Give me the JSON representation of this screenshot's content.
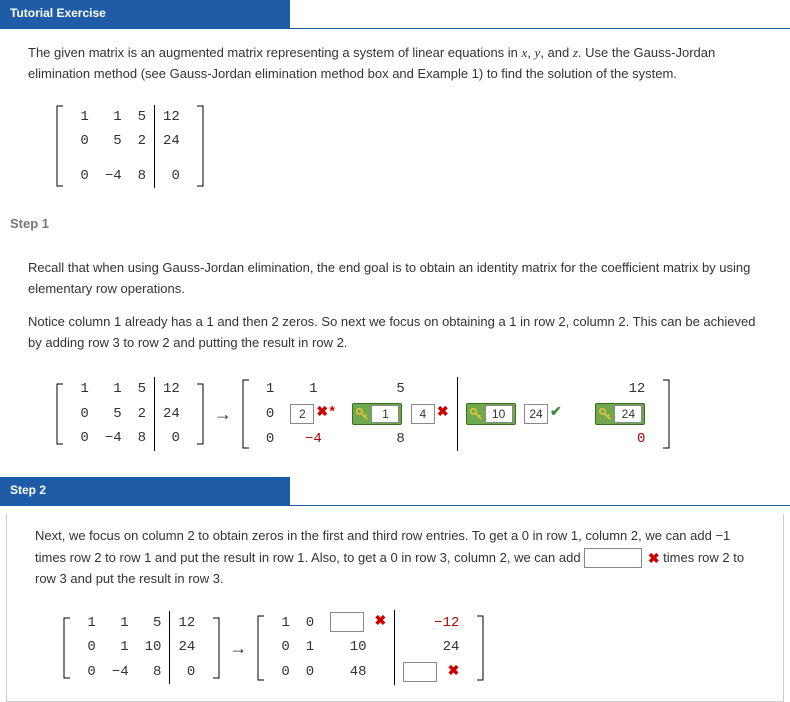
{
  "tutorial_header": "Tutorial Exercise",
  "intro": {
    "text1": "The given matrix is an augmented matrix representing a system of linear equations in ",
    "vars": "x, y, and z",
    "text2": ". Use the Gauss-Jordan elimination method (see Gauss-Jordan elimination method box and Example 1) to find the solution of the system.",
    "matrix": {
      "r1": [
        "1",
        "1",
        "5",
        "12"
      ],
      "r2": [
        "0",
        "5",
        "2",
        "24"
      ],
      "r3": [
        "0",
        "−4",
        "8",
        "0"
      ]
    }
  },
  "step1": {
    "label": "Step 1",
    "p1": "Recall that when using Gauss-Jordan elimination, the end goal is to obtain an identity matrix for the coefficient matrix by using elementary row operations.",
    "p2": "Notice column 1 already has a 1 and then 2 zeros. So next we focus on obtaining a 1 in row 2, column 2. This can be achieved by adding row 3 to row 2 and putting the result in row 2.",
    "leftMatrix": {
      "r1": [
        "1",
        "1",
        "5",
        "12"
      ],
      "r2": [
        "0",
        "5",
        "2",
        "24"
      ],
      "r3": [
        "0",
        "−4",
        "8",
        "0"
      ]
    },
    "rightMatrix": {
      "r1c1": "1",
      "r1c2": "1",
      "r1c3": "5",
      "r1c4": "12",
      "r2c1": "0",
      "r2c2_input": "2",
      "r2c2_mark": "✖*",
      "r2c3_key": "1",
      "r2c3_after": "4",
      "r2c3_mark": "✖",
      "r2c4_key": "10",
      "r2c4_after": "24",
      "r2c4_mark": "✔",
      "r2c5_key": "24",
      "r3c1": "0",
      "r3c2": "−4",
      "r3c3": "8",
      "r3c4": "0"
    }
  },
  "step2": {
    "label": "Step 2",
    "p1a": "Next, we focus on column 2 to obtain zeros in the first and third row entries. To get a 0 in row 1, column 2, we can add −1 times row 2 to row 1 and put the result in row 1. Also, to get a 0 in row 3, column 2, we can add ",
    "p1b": " times row 2 to row 3 and put the result in row 3.",
    "blank_val": "",
    "leftMatrix": {
      "r1": [
        "1",
        "1",
        "5",
        "12"
      ],
      "r2": [
        "0",
        "1",
        "10",
        "24"
      ],
      "r3": [
        "0",
        "−4",
        "8",
        "0"
      ]
    },
    "rightMatrix": {
      "r1": [
        "1",
        "0",
        "",
        "−12"
      ],
      "r1_mark": "✖",
      "r2": [
        "0",
        "1",
        "10",
        "24"
      ],
      "r3": [
        "0",
        "0",
        "48",
        ""
      ],
      "r3_mark": "✖"
    }
  }
}
